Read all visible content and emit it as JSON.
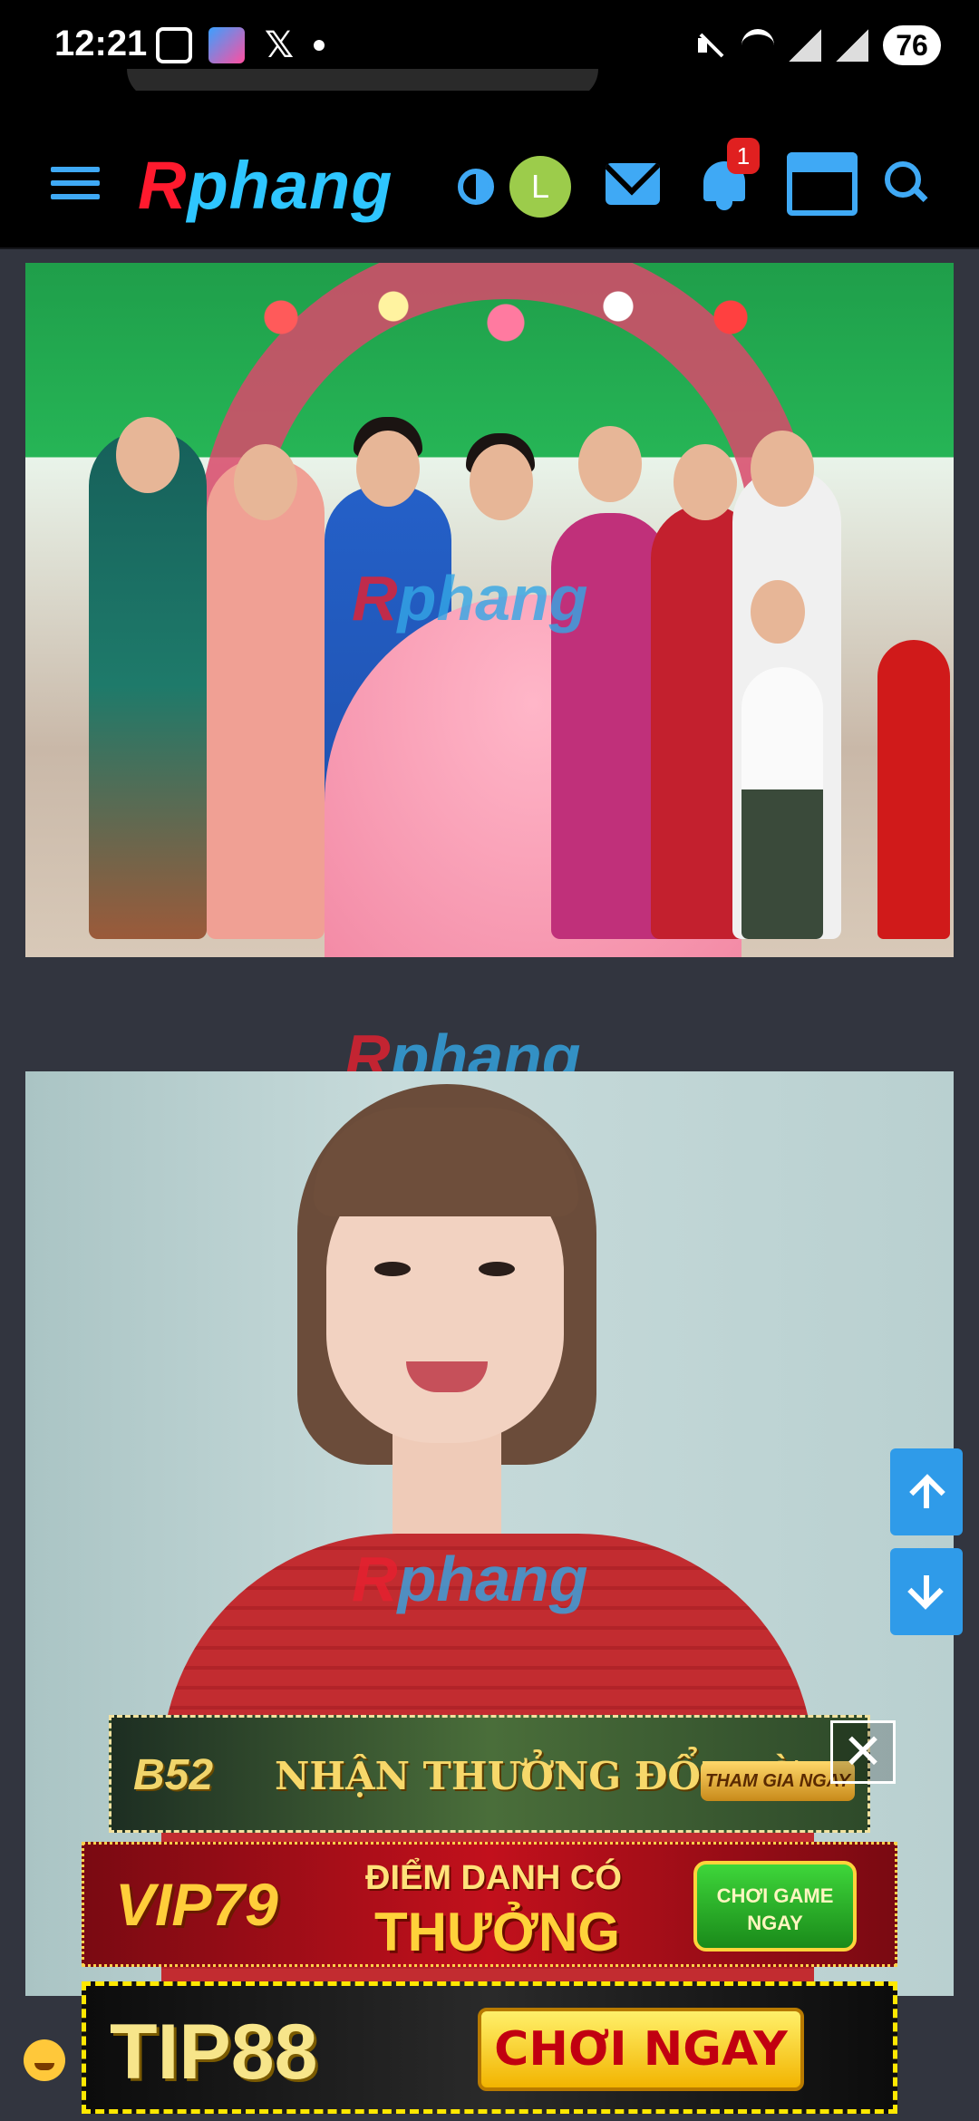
{
  "status_bar": {
    "time": "12:21",
    "battery": "76",
    "icons_left": [
      "screenshot-icon",
      "app-icon",
      "x-icon",
      "dot-icon"
    ],
    "icons_right": [
      "mute-icon",
      "wifi-icon",
      "signal-icon",
      "signal-icon",
      "battery-icon"
    ]
  },
  "header": {
    "logo_r": "R",
    "logo_rest": "phang",
    "avatar_letter": "L",
    "notification_count": "1",
    "icons": [
      "menu-icon",
      "contrast-icon",
      "mail-icon",
      "bell-icon",
      "store-icon",
      "search-icon"
    ]
  },
  "watermarks": {
    "page_r": "R",
    "page_rest": "phang",
    "photo1_r": "R",
    "photo1_rest": "phang",
    "photo2_r": "R",
    "photo2_rest": "phang"
  },
  "scroll_buttons": {
    "up": "arrow-up-icon",
    "down": "arrow-down-icon"
  },
  "ads": {
    "b52": {
      "brand": "B52",
      "headline": "NHẬN THƯỞNG ĐỔI ĐỜI",
      "cta": "THAM GIA NGAY"
    },
    "vip79": {
      "brand": "VIP79",
      "line1": "ĐIỂM DANH CÓ",
      "line2": "THƯỞNG",
      "cta_line1": "CHƠI GAME",
      "cta_line2": "NGAY"
    },
    "tip88": {
      "brand": "TIP88",
      "cta": "CHƠI NGAY"
    },
    "close_symbol": "✕"
  },
  "colors": {
    "accent": "#3fa9f5",
    "background": "#32353f",
    "logo_red": "#ff1a2e",
    "logo_blue": "#2ec6ff",
    "badge_red": "#e02020"
  }
}
